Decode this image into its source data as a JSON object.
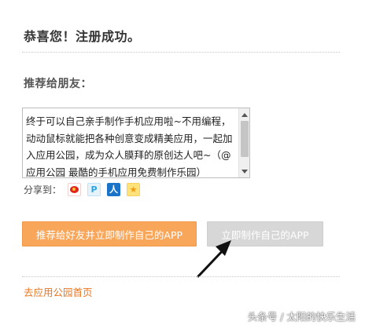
{
  "header": {
    "title": "恭喜您！注册成功。"
  },
  "recommend": {
    "title": "推荐给朋友：",
    "message": "终于可以自己亲手制作手机应用啦~不用编程，动动鼠标就能把各种创意变成精美应用，一起加入应用公园，成为众人膜拜的原创达人吧~（@应用公园 最酷的手机应用免费制作乐园）",
    "share_label": "分享到：",
    "share_icons": [
      "weibo-icon",
      "p-icon",
      "renren-icon",
      "star-icon"
    ]
  },
  "actions": {
    "primary_label": "推荐给好友并立即制作自己的APP",
    "secondary_label": "立即制作自己的APP"
  },
  "footer": {
    "home_link": "去应用公园首页"
  },
  "watermark": "头条号 / 太阳的快乐生活",
  "colors": {
    "primary_button": "#f8a65a",
    "secondary_button": "#d7d7d7",
    "link": "#e87722"
  }
}
